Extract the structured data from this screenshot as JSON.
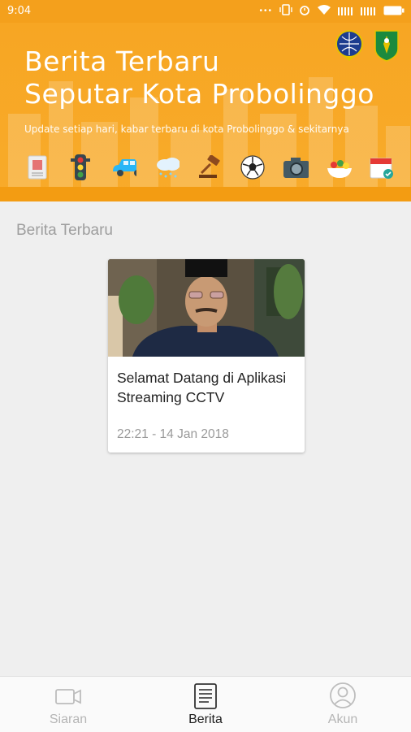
{
  "status_bar": {
    "time": "9:04"
  },
  "header": {
    "title_line1": "Berita Terbaru",
    "title_line2": "Seputar Kota Probolinggo",
    "subtitle": "Update setiap hari, kabar terbaru di kota Probolinggo & sekitarnya",
    "categories": [
      "newspaper-icon",
      "traffic-light-icon",
      "car-icon",
      "rain-cloud-icon",
      "gavel-icon",
      "soccer-ball-icon",
      "camera-icon",
      "food-icon",
      "calendar-icon"
    ]
  },
  "section": {
    "title": "Berita Terbaru"
  },
  "news": [
    {
      "title": "Selamat Datang di Aplikasi Streaming CCTV",
      "timestamp": "22:21 - 14 Jan 2018"
    }
  ],
  "bottom_nav": {
    "items": [
      {
        "label": "Siaran",
        "icon": "video-camera-icon",
        "active": false
      },
      {
        "label": "Berita",
        "icon": "news-icon",
        "active": true
      },
      {
        "label": "Akun",
        "icon": "account-icon",
        "active": false
      }
    ]
  },
  "colors": {
    "primary": "#f7a623",
    "active_text": "#212121",
    "inactive_text": "#b5b5b5"
  }
}
